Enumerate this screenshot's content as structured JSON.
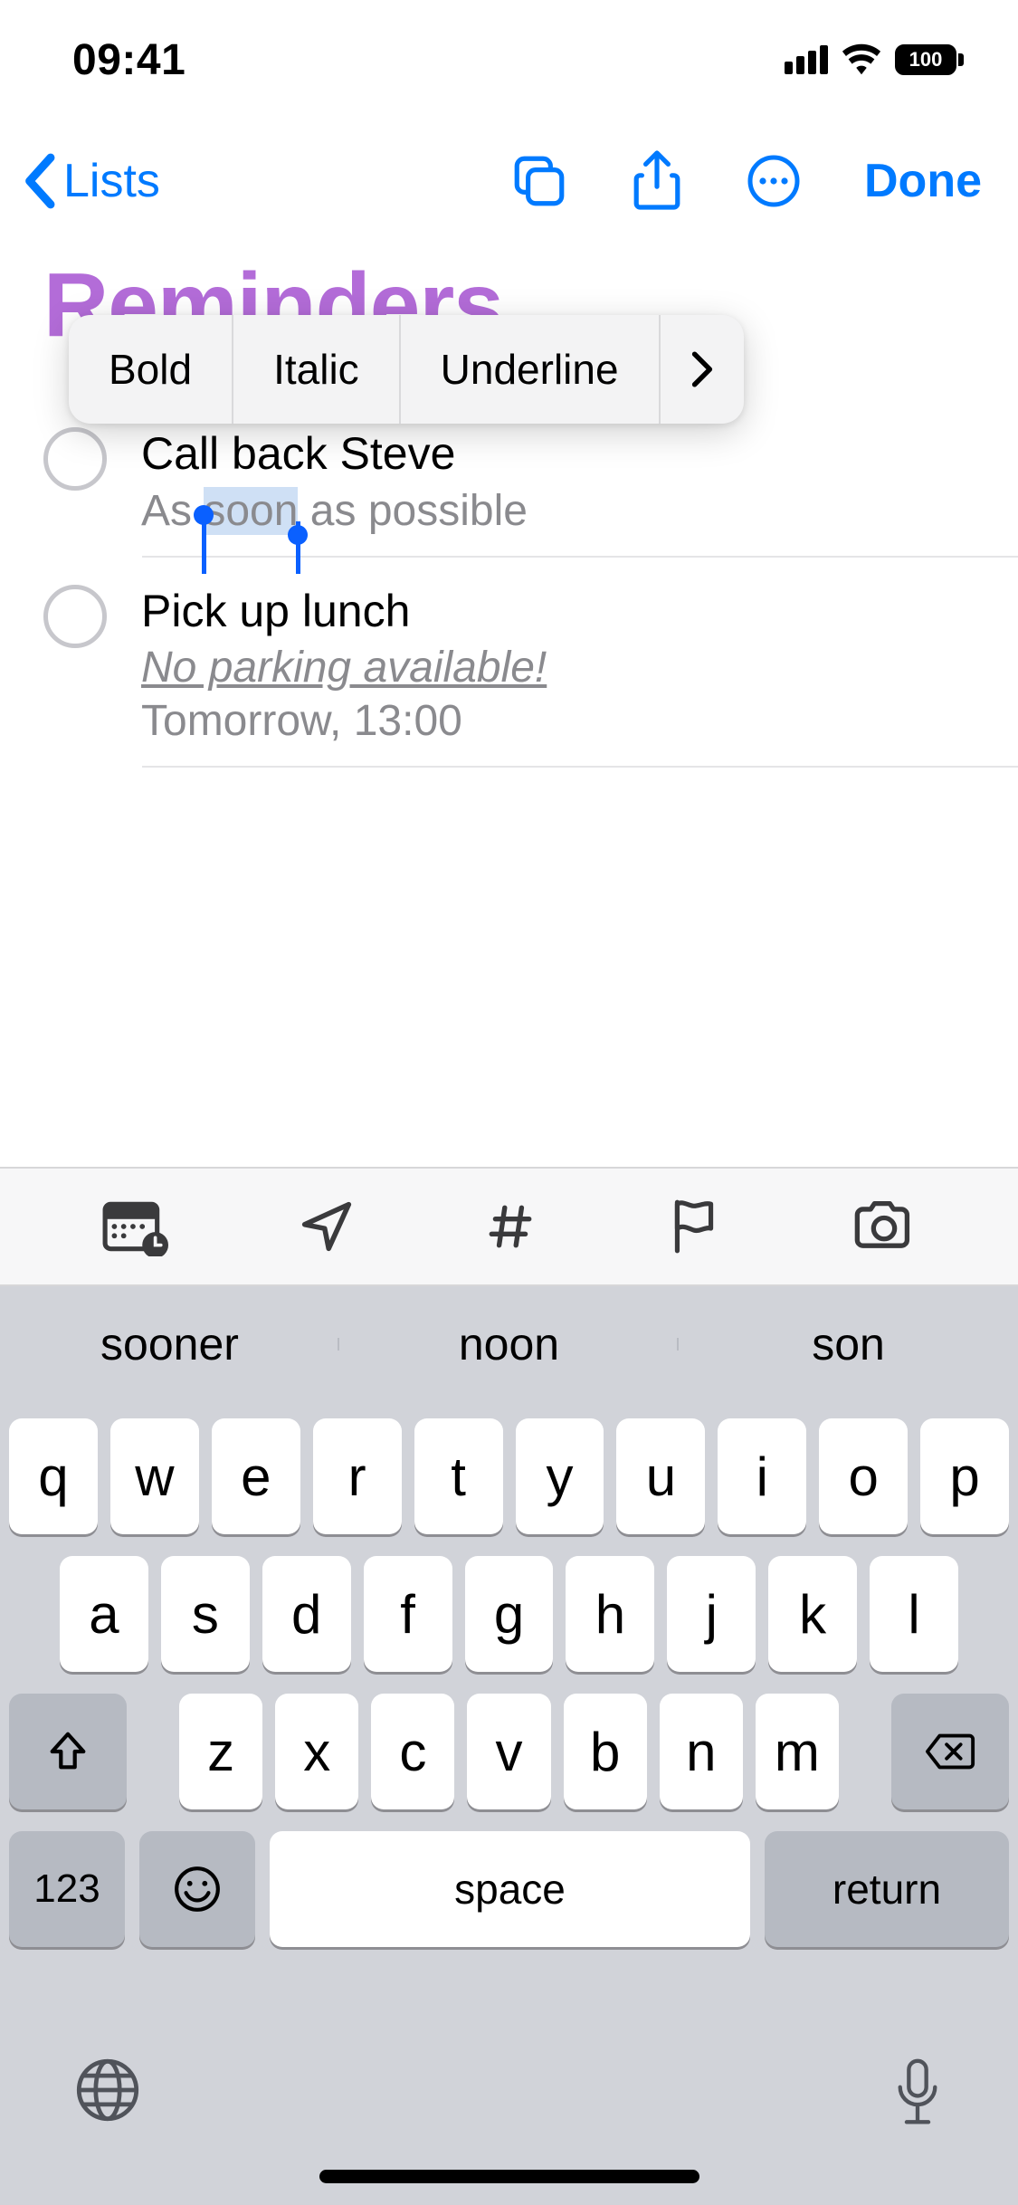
{
  "status_bar": {
    "time": "09:41",
    "battery_text": "100"
  },
  "nav": {
    "back_label": "Lists",
    "done_label": "Done"
  },
  "list": {
    "title": "Reminders",
    "items": [
      {
        "title": "Call back Steve",
        "note_before": "As ",
        "note_selected": "soon",
        "note_after": " as possible"
      },
      {
        "title": "Pick up lunch",
        "note": "No parking available!",
        "date": "Tomorrow, 13:00"
      }
    ]
  },
  "edit_menu": {
    "bold": "Bold",
    "italic": "Italic",
    "underline": "Underline"
  },
  "keyboard": {
    "suggestions": [
      "sooner",
      "noon",
      "son"
    ],
    "row1": [
      "q",
      "w",
      "e",
      "r",
      "t",
      "y",
      "u",
      "i",
      "o",
      "p"
    ],
    "row2": [
      "a",
      "s",
      "d",
      "f",
      "g",
      "h",
      "j",
      "k",
      "l"
    ],
    "row3": [
      "z",
      "x",
      "c",
      "v",
      "b",
      "n",
      "m"
    ],
    "numbers_label": "123",
    "space_label": "space",
    "return_label": "return"
  }
}
